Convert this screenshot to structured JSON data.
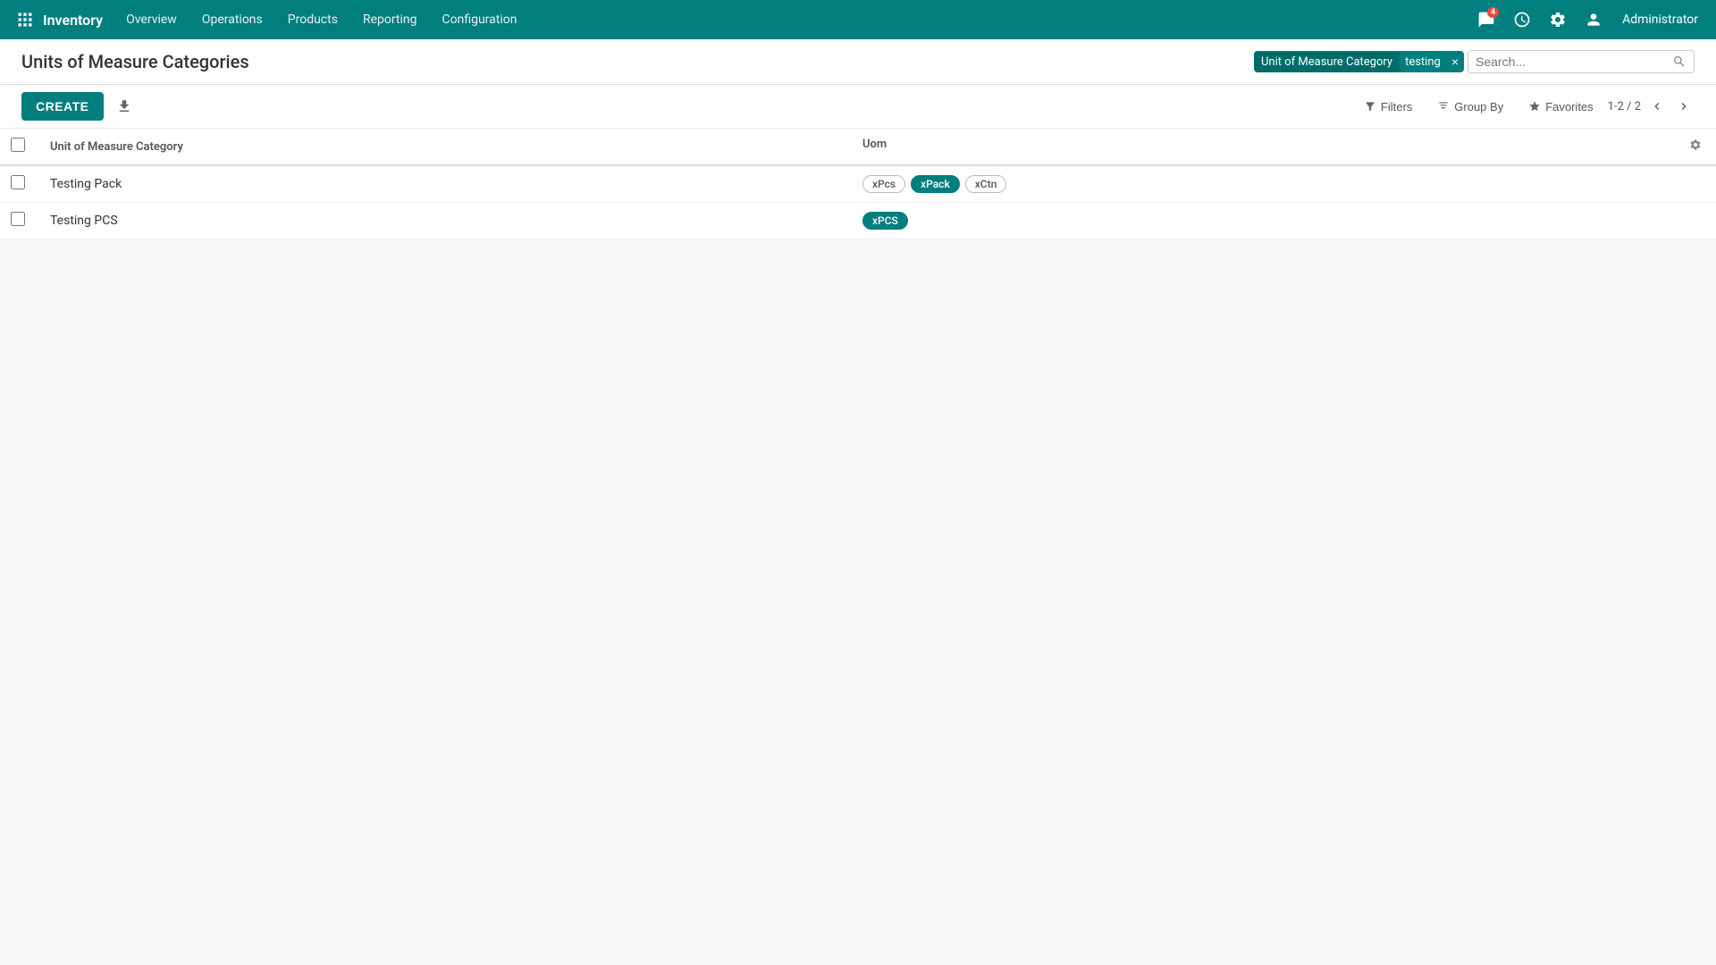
{
  "app": {
    "name": "Inventory"
  },
  "nav": {
    "menu_items": [
      "Overview",
      "Operations",
      "Products",
      "Reporting",
      "Configuration"
    ]
  },
  "topnav_right": {
    "messages_count": "4",
    "user": "Administrator"
  },
  "page": {
    "title": "Units of Measure Categories"
  },
  "toolbar": {
    "create_label": "CREATE"
  },
  "search": {
    "filter_tag_label": "Unit of Measure Category",
    "filter_tag_value": "testing",
    "placeholder": "Search..."
  },
  "filter_bar": {
    "filters_label": "Filters",
    "group_by_label": "Group By",
    "favorites_label": "Favorites",
    "pagination": "1-2 / 2"
  },
  "table": {
    "col_category": "Unit of Measure Category",
    "col_uom": "Uom",
    "rows": [
      {
        "name": "Testing Pack",
        "badges": [
          {
            "label": "xPcs",
            "type": "outline"
          },
          {
            "label": "xPack",
            "type": "filled"
          },
          {
            "label": "xCtn",
            "type": "outline"
          }
        ]
      },
      {
        "name": "Testing PCS",
        "badges": [
          {
            "label": "xPCS",
            "type": "filled"
          }
        ]
      }
    ]
  }
}
